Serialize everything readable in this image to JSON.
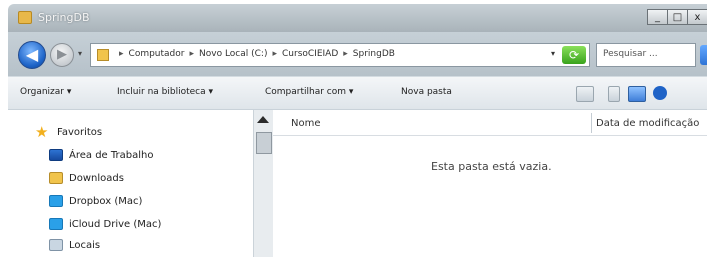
{
  "window": {
    "title": "SpringDB"
  },
  "window_controls": [
    "_",
    "□",
    "x"
  ],
  "navigation": {
    "breadcrumbs": [
      "Computador",
      "Novo Local (C:)",
      "CursoCIEIAD",
      "SpringDB"
    ],
    "search_placeholder": "Pesquisar ..."
  },
  "toolbar": {
    "organize": "Organizar ▾",
    "include_library": "Incluir na biblioteca ▾",
    "share_with": "Compartilhar com ▾",
    "new_folder": "Nova pasta"
  },
  "sidebar": {
    "items": [
      {
        "label": "Favoritos",
        "icon": "star-icon"
      },
      {
        "label": "Área de Trabalho",
        "icon": "desktop-icon"
      },
      {
        "label": "Downloads",
        "icon": "downloads-folder-icon"
      },
      {
        "label": "Dropbox (Mac)",
        "icon": "dropbox-icon"
      },
      {
        "label": "iCloud Drive (Mac)",
        "icon": "icloud-icon"
      },
      {
        "label": "Locais",
        "icon": "places-icon"
      }
    ]
  },
  "content": {
    "columns": [
      "Nome",
      "Data de modificação"
    ],
    "empty_message": "Esta pasta está vazia."
  },
  "colors": {
    "titlebar": "#b0bac1",
    "accent_blue": "#1e64c8",
    "folder_yellow": "#f1c44c"
  }
}
